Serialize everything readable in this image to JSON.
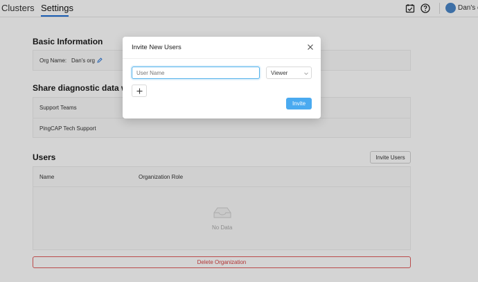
{
  "nav": {
    "tabs": [
      {
        "label": "Clusters",
        "active": false
      },
      {
        "label": "Settings",
        "active": true
      }
    ],
    "user_org": "Dan's org",
    "icons": [
      "calendar-check-icon",
      "help-icon",
      "avatar-icon"
    ]
  },
  "basic_info": {
    "title": "Basic Information",
    "org_label": "Org Name:",
    "org_value": "Dan's org"
  },
  "share": {
    "title": "Share diagnostic data with",
    "header": "Support Teams",
    "rows": [
      "PingCAP Tech Support"
    ]
  },
  "users": {
    "title": "Users",
    "invite_button": "Invite Users",
    "columns": [
      "Name",
      "Organization Role"
    ],
    "empty_text": "No Data"
  },
  "delete_button": "Delete Organization",
  "modal": {
    "title": "Invite New Users",
    "username_placeholder": "User Name",
    "role_value": "Viewer",
    "submit_label": "Invite"
  },
  "colors": {
    "accent": "#1f6fd6",
    "primary_button": "#4aaaf0",
    "danger": "#d64040"
  }
}
